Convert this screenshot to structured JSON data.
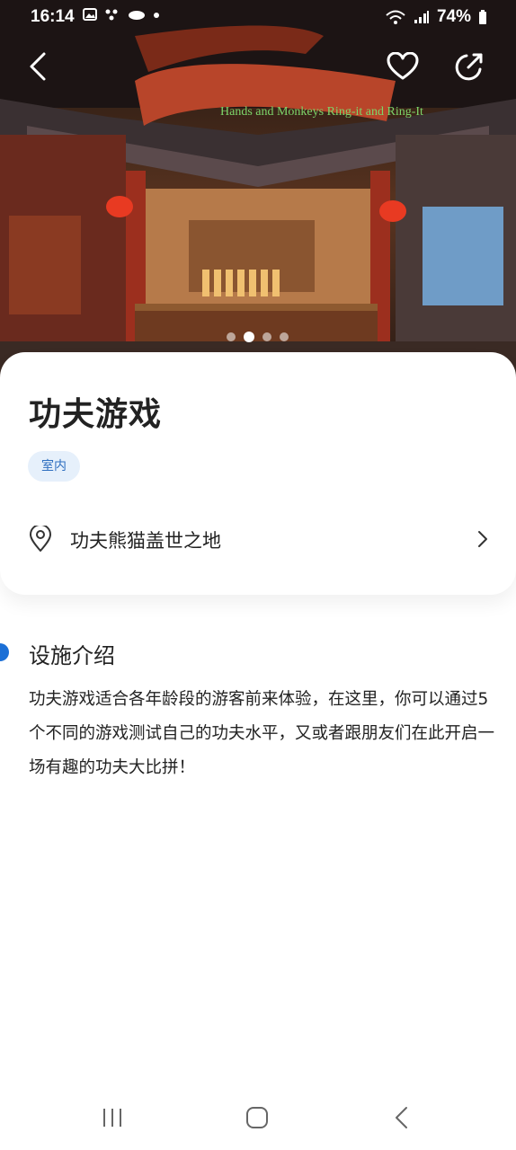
{
  "status_bar": {
    "time": "16:14",
    "battery": "74%"
  },
  "header": {
    "back_icon": "chevron-left-icon",
    "favorite_icon": "heart-outline-icon",
    "share_icon": "share-icon"
  },
  "hero": {
    "sign_text": "Hands and Monkeys Ring-it and Ring-It",
    "page_count": 4,
    "active_page": 2
  },
  "attraction": {
    "title": "功夫游戏",
    "tag": "室内",
    "location": "功夫熊猫盖世之地"
  },
  "description": {
    "heading": "设施介绍",
    "body": "功夫游戏适合各年龄段的游客前来体验，在这里，你可以通过5个不同的游戏测试自己的功夫水平，又或者跟朋友们在此开启一场有趣的功夫大比拼！"
  },
  "colors": {
    "accent": "#1b6fd6",
    "tag_bg": "#e6f0fb",
    "tag_text": "#2f6fc0"
  }
}
